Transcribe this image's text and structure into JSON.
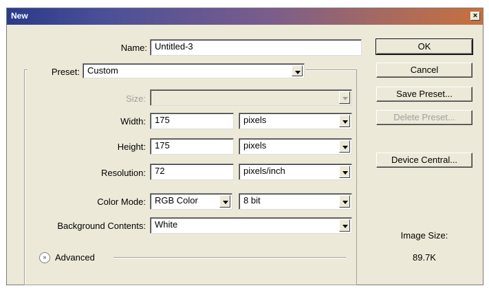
{
  "dialog": {
    "title": "New",
    "close_glyph": "×"
  },
  "form": {
    "name_label": "Name:",
    "name_value": "Untitled-3",
    "preset_label": "Preset:",
    "preset_value": "Custom",
    "size_label": "Size:",
    "size_value": "",
    "width_label": "Width:",
    "width_value": "175",
    "width_unit": "pixels",
    "height_label": "Height:",
    "height_value": "175",
    "height_unit": "pixels",
    "resolution_label": "Resolution:",
    "resolution_value": "72",
    "resolution_unit": "pixels/inch",
    "color_mode_label": "Color Mode:",
    "color_mode_value": "RGB Color",
    "bit_depth_value": "8 bit",
    "background_label": "Background Contents:",
    "background_value": "White",
    "advanced_label": "Advanced"
  },
  "buttons": {
    "ok": "OK",
    "cancel": "Cancel",
    "save_preset": "Save Preset...",
    "delete_preset": "Delete Preset...",
    "device_central": "Device Central..."
  },
  "image_size": {
    "label": "Image Size:",
    "value": "89.7K"
  }
}
